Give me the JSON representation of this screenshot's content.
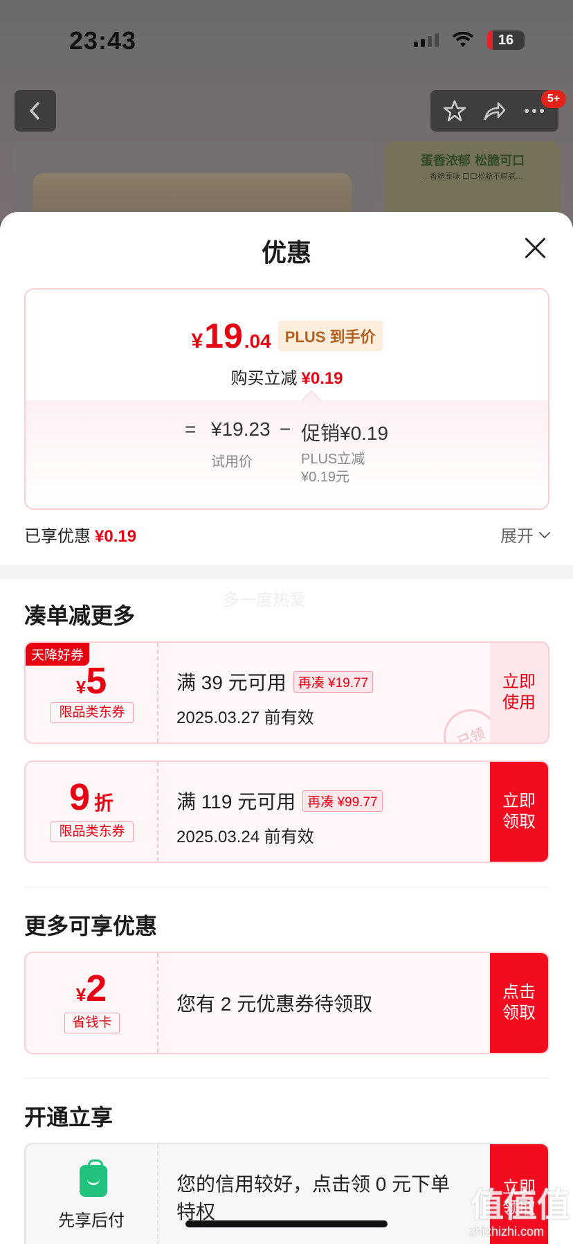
{
  "status_bar": {
    "time": "23:43",
    "battery": "16"
  },
  "nav": {
    "badge": "5+"
  },
  "product_banner": {
    "title": "蛋香浓郁 松脆可口",
    "subtitle": "…香脆原味 口口松脆不腻腻…"
  },
  "sheet": {
    "title": "优惠",
    "price": {
      "yen": "¥",
      "integer": "19",
      "decimal": ".04",
      "plus_tag": "PLUS 到手价"
    },
    "buy_line": {
      "label": "购买立减",
      "amount": "¥0.19"
    },
    "formula": {
      "equals": "=",
      "trial_price": "¥19.23",
      "minus": "−",
      "promo": "促销¥0.19",
      "trial_label": "试用价",
      "promo_label_1": "PLUS立减",
      "promo_label_2": "¥0.19元"
    },
    "enjoyed": {
      "label": "已享优惠",
      "amount": "¥0.19",
      "expand": "展开"
    }
  },
  "section_combine": {
    "title": "凑单减更多",
    "watermark": "多一度热爱",
    "coupons": [
      {
        "corner": "天降好券",
        "currency": "¥",
        "amount": "5",
        "unit": "",
        "type": "限品类东券",
        "condition": "满 39 元可用",
        "tag": "再凑 ¥19.77",
        "date": "2025.03.27 前有效",
        "action": "立即\n使用",
        "stamp": "已领"
      },
      {
        "corner": "",
        "currency": "",
        "amount": "9",
        "unit": "折",
        "type": "限品类东券",
        "condition": "满 119 元可用",
        "tag": "再凑 ¥99.77",
        "date": "2025.03.24 前有效",
        "action": "立即\n领取"
      }
    ]
  },
  "section_more": {
    "title": "更多可享优惠",
    "card": {
      "currency": "¥",
      "amount": "2",
      "type": "省钱卡",
      "text": "您有 2 元优惠券待领取",
      "action": "点击\n领取"
    }
  },
  "section_open": {
    "title": "开通立享",
    "card": {
      "icon": "shopping-bag-icon",
      "label": "先享后付",
      "text": "您的信用较好，点击领 0 元下单特权",
      "action": "立即\n领取"
    }
  },
  "watermark_site": {
    "logo": "值值值",
    "url": "zhizhizhi.com"
  },
  "colors": {
    "accent": "#e60012",
    "action_red": "#f20c1f",
    "green": "#21c27d"
  }
}
